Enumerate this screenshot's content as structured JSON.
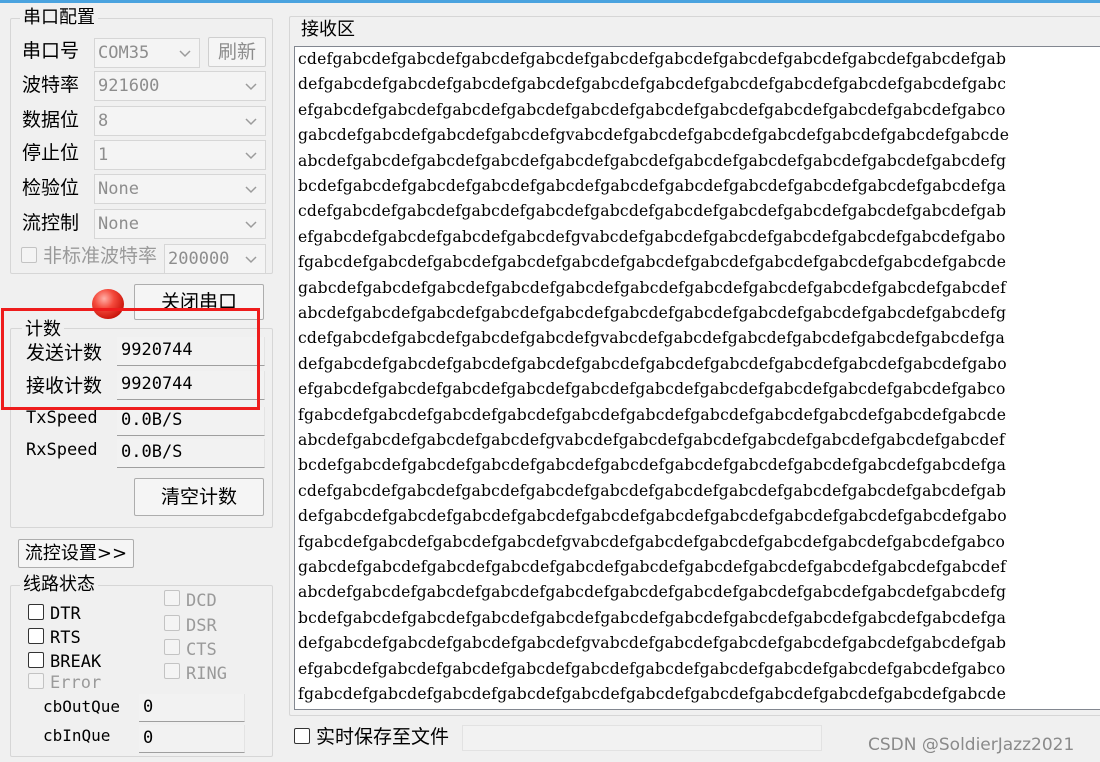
{
  "serial_config": {
    "title": "串口配置",
    "port_label": "串口号",
    "port_value": "COM35",
    "refresh_label": "刷新",
    "baud_label": "波特率",
    "baud_value": "921600",
    "databits_label": "数据位",
    "databits_value": "8",
    "stopbits_label": "停止位",
    "stopbits_value": "1",
    "parity_label": "检验位",
    "parity_value": "None",
    "flow_label": "流控制",
    "flow_value": "None",
    "custom_baud_label": "非标准波特率",
    "custom_baud_value": "200000",
    "close_port_label": "关闭串口",
    "port_open_indicator_color": "#e8271a"
  },
  "count": {
    "title": "计数",
    "sent_label": "发送计数",
    "sent_value": "9920744",
    "recv_label": "接收计数",
    "recv_value": "9920744",
    "txspeed_label": "TxSpeed",
    "txspeed_value": "0.0B/S",
    "rxspeed_label": "RxSpeed",
    "rxspeed_value": "0.0B/S",
    "clear_label": "清空计数"
  },
  "flow_settings_label": "流控设置>>",
  "line_status": {
    "title": "线路状态",
    "dtr": "DTR",
    "rts": "RTS",
    "break": "BREAK",
    "error": "Error",
    "dcd": "DCD",
    "dsr": "DSR",
    "cts": "CTS",
    "ring": "RING",
    "cb_out_label": "cbOutQue",
    "cb_out_value": "0",
    "cb_in_label": "cbInQue",
    "cb_in_value": "0"
  },
  "receive": {
    "title": "接收区",
    "lines": [
      "cdefgabcdefgabcdefgabcdefgabcdefgabcdefgabcdefgabcdefgabcdefgabcdefgabcdefgab",
      "defgabcdefgabcdefgabcdefgabcdefgabcdefgabcdefgabcdefgabcdefgabcdefgabcdefgabc",
      "efgabcdefgabcdefgabcdefgabcdefgabcdefgabcdefgabcdefgabcdefgabcdefgabcdefgabco",
      "gabcdefgabcdefgabcdefgabcdefgvabcdefgabcdefgabcdefgabcdefgabcdefgabcdefgabcde",
      "abcdefgabcdefgabcdefgabcdefgabcdefgabcdefgabcdefgabcdefgabcdefgabcdefgabcdefg",
      "bcdefgabcdefgabcdefgabcdefgabcdefgabcdefgabcdefgabcdefgabcdefgabcdefgabcdefga",
      "cdefgabcdefgabcdefgabcdefgabcdefgabcdefgabcdefgabcdefgabcdefgabcdefgabcdefgab",
      "efgabcdefgabcdefgabcdefgabcdefgvabcdefgabcdefgabcdefgabcdefgabcdefgabcdefgabo",
      "fgabcdefgabcdefgabcdefgabcdefgabcdefgabcdefgabcdefgabcdefgabcdefgabcdefgabcde",
      "gabcdefgabcdefgabcdefgabcdefgabcdefgabcdefgabcdefgabcdefgabcdefgabcdefgabcdef",
      "abcdefgabcdefgabcdefgabcdefgabcdefgabcdefgabcdefgabcdefgabcdefgabcdefgabcdefg",
      "cdefgabcdefgabcdefgabcdefgabcdefgvabcdefgabcdefgabcdefgabcdefgabcdefgabcdefga",
      "defgabcdefgabcdefgabcdefgabcdefgabcdefgabcdefgabcdefgabcdefgabcdefgabcdefgabo",
      "efgabcdefgabcdefgabcdefgabcdefgabcdefgabcdefgabcdefgabcdefgabcdefgabcdefgabco",
      "fgabcdefgabcdefgabcdefgabcdefgabcdefgabcdefgabcdefgabcdefgabcdefgabcdefgabcde",
      "abcdefgabcdefgabcdefgabcdefgvabcdefgabcdefgabcdefgabcdefgabcdefgabcdefgabcdef",
      "bcdefgabcdefgabcdefgabcdefgabcdefgabcdefgabcdefgabcdefgabcdefgabcdefgabcdefga",
      "cdefgabcdefgabcdefgabcdefgabcdefgabcdefgabcdefgabcdefgabcdefgabcdefgabcdefgab",
      "defgabcdefgabcdefgabcdefgabcdefgabcdefgabcdefgabcdefgabcdefgabcdefgabcdefgabo",
      "fgabcdefgabcdefgabcdefgabcdefgvabcdefgabcdefgabcdefgabcdefgabcdefgabcdefgabco",
      "gabcdefgabcdefgabcdefgabcdefgabcdefgabcdefgabcdefgabcdefgabcdefgabcdefgabcdef",
      "abcdefgabcdefgabcdefgabcdefgabcdefgabcdefgabcdefgabcdefgabcdefgabcdefgabcdefg",
      "bcdefgabcdefgabcdefgabcdefgabcdefgabcdefgabcdefgabcdefgabcdefgabcdefgabcdefga",
      "defgabcdefgabcdefgabcdefgabcdefgvabcdefgabcdefgabcdefgabcdefgabcdefgabcdefgab",
      "efgabcdefgabcdefgabcdefgabcdefgabcdefgabcdefgabcdefgabcdefgabcdefgabcdefgabco",
      "fgabcdefgabcdefgabcdefgabcdefgabcdefgabcdefgabcdefgabcdefgabcdefgabcdefgabcde"
    ],
    "save_realtime_label": "实时保存至文件"
  },
  "watermark": "CSDN @SoldierJazz2021",
  "highlight_color": "#ee1c1c"
}
